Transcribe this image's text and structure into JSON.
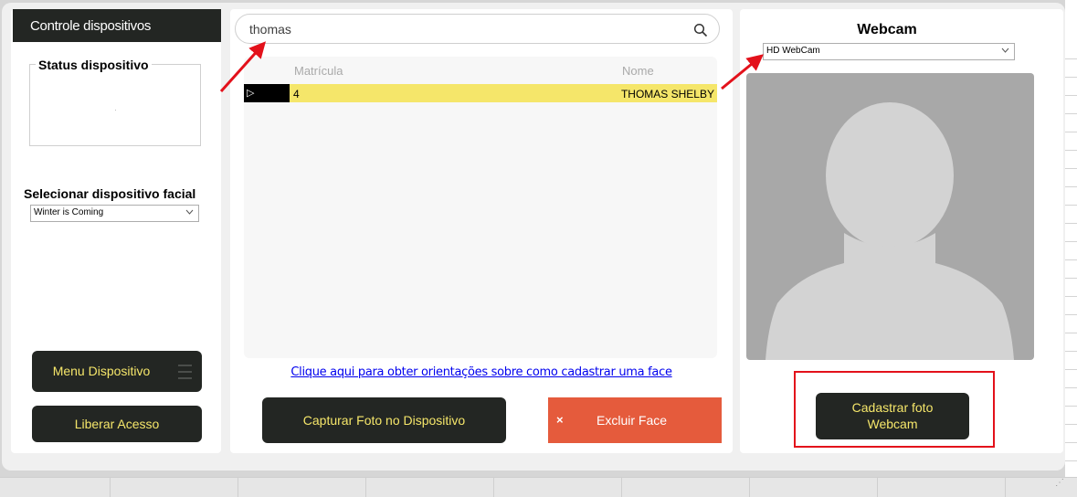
{
  "left_panel": {
    "title": "Controle dispositivos",
    "status_group_label": "Status dispositivo",
    "select_label": "Selecionar dispositivo facial",
    "select_value": "Winter is Coming",
    "menu_button": "Menu Dispositivo",
    "liberar_button": "Liberar Acesso"
  },
  "search": {
    "value": "thomas"
  },
  "grid": {
    "columns": [
      "Matrícula",
      "Nome"
    ],
    "rows": [
      {
        "indicator": "▷",
        "matricula": "4",
        "nome": "THOMAS SHELBY"
      }
    ]
  },
  "help_link": "Clique aqui para obter orientações sobre como cadastrar uma face",
  "actions": {
    "capturar": "Capturar Foto no Dispositivo",
    "excluir_icon": "×",
    "excluir": "Excluir Face"
  },
  "webcam": {
    "title": "Webcam",
    "select_value": "HD WebCam",
    "cadastrar_line1": "Cadastrar foto",
    "cadastrar_line2": "Webcam"
  },
  "colors": {
    "dark": "#232623",
    "accent_yellow": "#f5e66a",
    "danger": "#e55b3c",
    "annotation_red": "#e3111b"
  },
  "icons": {
    "search": "search-icon",
    "dropdown": "chevron-down-icon",
    "menu": "hamburger-icon",
    "avatar": "person-silhouette-icon",
    "row_indicator": "row-pointer-icon"
  }
}
